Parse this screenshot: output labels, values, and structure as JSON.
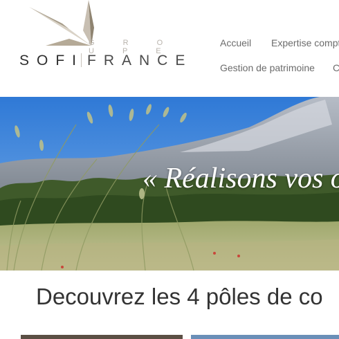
{
  "logo": {
    "groupe": "G R O U P E",
    "name_part1": "SOFI",
    "name_part2": "FRANCE"
  },
  "nav": {
    "items": [
      {
        "label": "Accueil"
      },
      {
        "label": "Expertise compt"
      },
      {
        "label": "Gestion de patrimoine"
      },
      {
        "label": "C"
      }
    ]
  },
  "hero": {
    "slogan": "« Réalisons vos o"
  },
  "section": {
    "title": "Decouvrez les 4 pôles de co"
  },
  "colors": {
    "accent": "#8a7a5e",
    "nav_text": "#6b6b6b",
    "title_text": "#333333"
  }
}
